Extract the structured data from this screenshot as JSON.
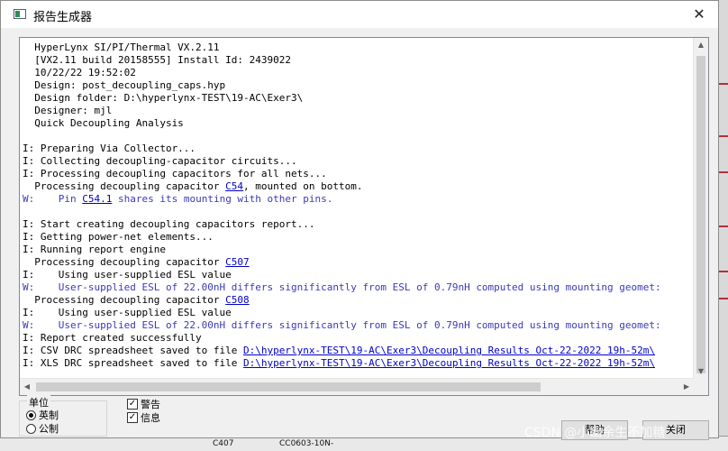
{
  "window": {
    "title": "报告生成器",
    "close_glyph": "✕"
  },
  "log": {
    "lines": [
      {
        "type": "info",
        "text": "  HyperLynx SI/PI/Thermal VX.2.11"
      },
      {
        "type": "info",
        "text": "  [VX2.11 build 20158555] Install Id: 2439022"
      },
      {
        "type": "info",
        "text": "  10/22/22 19:52:02"
      },
      {
        "type": "info",
        "text": "  Design: post_decoupling_caps.hyp"
      },
      {
        "type": "info",
        "text": "  Design folder: D:\\hyperlynx-TEST\\19-AC\\Exer3\\"
      },
      {
        "type": "info",
        "text": "  Designer: mjl"
      },
      {
        "type": "info",
        "text": "  Quick Decoupling Analysis"
      },
      {
        "type": "info",
        "text": ""
      },
      {
        "type": "info",
        "text": "I: Preparing Via Collector..."
      },
      {
        "type": "info",
        "text": "I: Collecting decoupling-capacitor circuits..."
      },
      {
        "type": "info",
        "text": "I: Processing decoupling capacitors for all nets..."
      },
      {
        "type": "info",
        "pre": "  Processing decoupling capacitor ",
        "link": "C54",
        "post": ", mounted on bottom."
      },
      {
        "type": "warn",
        "pre": "W:    Pin ",
        "link": "C54.1",
        "post": " shares its mounting with other pins."
      },
      {
        "type": "info",
        "text": ""
      },
      {
        "type": "info",
        "text": "I: Start creating decoupling capacitors report..."
      },
      {
        "type": "info",
        "text": "I: Getting power-net elements..."
      },
      {
        "type": "info",
        "text": "I: Running report engine"
      },
      {
        "type": "info",
        "pre": "  Processing decoupling capacitor ",
        "link": "C507",
        "post": ""
      },
      {
        "type": "info",
        "text": "I:    Using user-supplied ESL value"
      },
      {
        "type": "warn",
        "text": "W:    User-supplied ESL of 22.00nH differs significantly from ESL of 0.79nH computed using mounting geomet:"
      },
      {
        "type": "info",
        "pre": "  Processing decoupling capacitor ",
        "link": "C508",
        "post": ""
      },
      {
        "type": "info",
        "text": "I:    Using user-supplied ESL value"
      },
      {
        "type": "warn",
        "text": "W:    User-supplied ESL of 22.00nH differs significantly from ESL of 0.79nH computed using mounting geomet:"
      },
      {
        "type": "info",
        "text": "I: Report created successfully"
      },
      {
        "type": "info",
        "pre": "I: CSV DRC spreadsheet saved to file ",
        "link": "D:\\hyperlynx-TEST\\19-AC\\Exer3\\Decoupling Results Oct-22-2022 19h-52m\\",
        "post": ""
      },
      {
        "type": "info",
        "pre": "I: XLS DRC spreadsheet saved to file ",
        "link": "D:\\hyperlynx-TEST\\19-AC\\Exer3\\Decoupling Results Oct-22-2022 19h-52m\\",
        "post": ""
      }
    ]
  },
  "units": {
    "legend": "单位",
    "options": [
      {
        "label": "英制",
        "selected": true
      },
      {
        "label": "公制",
        "selected": false
      }
    ]
  },
  "filters": [
    {
      "label": "警告",
      "checked": true
    },
    {
      "label": "信息",
      "checked": true
    }
  ],
  "buttons": {
    "help": "帮助",
    "close": "关闭"
  },
  "background": {
    "cell_a": "C407",
    "cell_b": "CC0603-10N-"
  },
  "watermark": "CSDN @小幽余生不加糖"
}
